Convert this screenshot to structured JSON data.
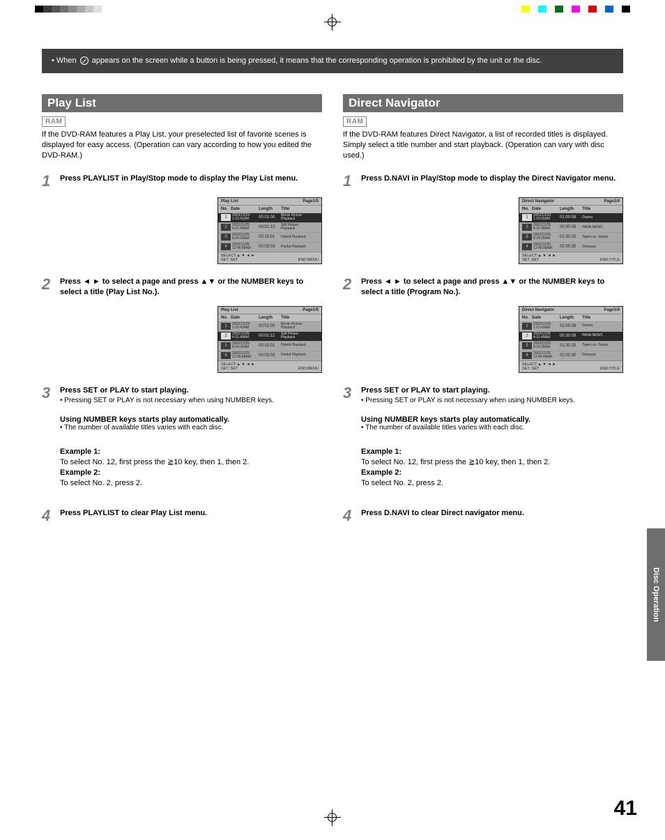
{
  "notice": {
    "prefix": "• When",
    "suffix": "appears on the screen while a button is being pressed, it means that the corresponding operation is prohibited by the unit or the disc."
  },
  "left": {
    "title": "Play List",
    "badge": "RAM",
    "intro": "If the DVD-RAM features a Play List, your preselected list of favorite scenes is displayed for easy access. (Operation can vary according to how you edited the DVD-RAM.)",
    "step1": "Press PLAYLIST in Play/Stop mode to display the Play List menu.",
    "step2": "Press ◄ ► to select a page and press ▲▼ or the NUMBER keys to select a title (Play List No.).",
    "step3": "Press SET or PLAY to start playing.",
    "step3sub": "Pressing SET or PLAY is not necessary when using NUMBER keys.",
    "step4": "Press PLAYLIST to clear Play List menu.",
    "menu": {
      "title": "Play List",
      "page": "Page1/5",
      "head": {
        "no": "No.",
        "date": "Date",
        "length": "Length",
        "title": "Title"
      },
      "rows": [
        {
          "n": "1",
          "d1": "2002/12/24",
          "d2": "1:15:41AM",
          "len": "00:01:00",
          "t1": "Movie Picture",
          "t2": "Playback"
        },
        {
          "n": "2",
          "d1": "2002/12/25",
          "d2": "4:31:49AM",
          "len": "00:01:12",
          "t1": "Still Picture",
          "t2": "Playback"
        },
        {
          "n": "3",
          "d1": "2002/12/25",
          "d2": "8:24:25AM",
          "len": "00:15:01",
          "t1": "Hybrid Playback",
          "t2": ""
        },
        {
          "n": "4",
          "d1": "2002/12/25",
          "d2": "12:45:08AM",
          "len": "00:03:03",
          "t1": "Partial Playback",
          "t2": ""
        }
      ],
      "foot_l1": "SELECT:▲ ▼  ◄ ►",
      "foot_l2": "SET    :SET",
      "foot_r": "END:MENU",
      "menu2_rows": [
        {
          "n": "1",
          "d1": "2002/12/24",
          "d2": "1:15:41AM",
          "len": "00:01:00",
          "t1": "Movie Picture",
          "t2": "Playback"
        },
        {
          "n": "2",
          "d1": "2002/12/25",
          "d2": "4:31:49AM",
          "len": "00:01:12",
          "t1": "Still Picture",
          "t2": "Playback"
        },
        {
          "n": "3",
          "d1": "2002/12/25",
          "d2": "8:24:25AM",
          "len": "00:15:01",
          "t1": "Hybrid Playback",
          "t2": ""
        },
        {
          "n": "4",
          "d1": "2002/12/25",
          "d2": "12:45:08AM",
          "len": "00:03:03",
          "t1": "Partial Playback",
          "t2": ""
        }
      ]
    }
  },
  "right": {
    "title": "Direct Navigator",
    "badge": "RAM",
    "intro": "If the DVD-RAM features Direct Navigator, a list of recorded titles is displayed. Simply select a title number and start playback. (Operation can vary with disc used.)",
    "step1": "Press D.NAVI in Play/Stop mode to display the Direct Navigator menu.",
    "step2": "Press ◄ ► to select a page and press ▲▼ or the NUMBER keys to select a title (Program No.).",
    "step3": "Press SET or PLAY to start playing.",
    "step3sub": "Pressing SET or PLAY is not necessary when using NUMBER keys.",
    "step4": "Press D.NAVI to clear Direct navigator menu.",
    "menu": {
      "title": "Direct Navigator",
      "page": "Page1/4",
      "head": {
        "no": "No.",
        "date": "Date",
        "length": "Length",
        "title": "Title"
      },
      "rows": [
        {
          "n": "1",
          "d1": "2002/12/24",
          "d2": "1:15:41AM",
          "len": "01:00:08",
          "t1": "Drama",
          "t2": ""
        },
        {
          "n": "2",
          "d1": "2002/12/25",
          "d2": "4:31:49AM",
          "len": "00:30:08",
          "t1": "PANA NEWS",
          "t2": ""
        },
        {
          "n": "3",
          "d1": "2002/12/25",
          "d2": "8:24:25AM",
          "len": "01:30:25",
          "t1": "Tigers vs. Giants",
          "t2": ""
        },
        {
          "n": "4",
          "d1": "2002/12/25",
          "d2": "12:45:08AM",
          "len": "02:00:30",
          "t1": "Dinosaur",
          "t2": ""
        }
      ],
      "foot_l1": "SELECT:▲ ▼  ◄ ►",
      "foot_l2": "SET    :SET",
      "foot_r": "END:TITLE"
    }
  },
  "note": {
    "bold": "Using NUMBER keys starts play automatically.",
    "sub": "The number of available titles varies with each disc."
  },
  "example": {
    "e1label": "Example 1:",
    "e1a": "To select No. 12, first press the ",
    "e1b": "10 key, then 1, then 2.",
    "geq": "≧",
    "e2label": "Example 2:",
    "e2": "To select No. 2, press 2."
  },
  "sidetab": "Disc Operation",
  "pagenum": "41"
}
